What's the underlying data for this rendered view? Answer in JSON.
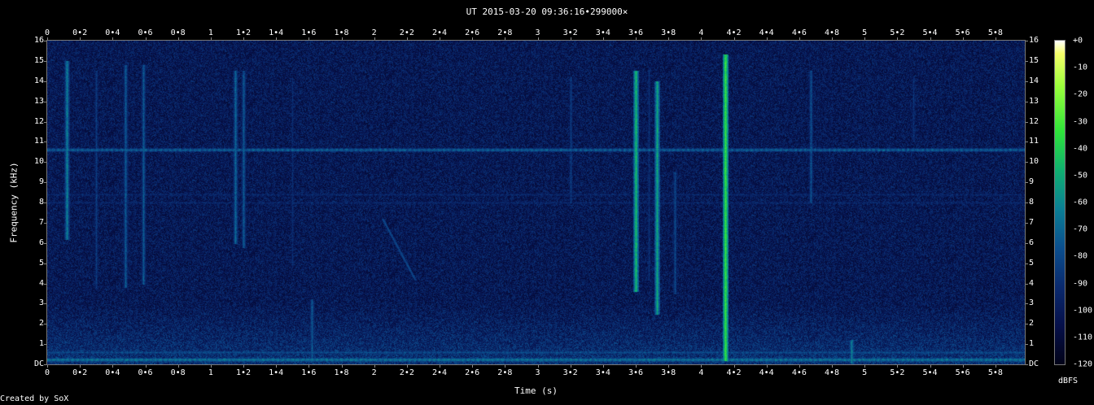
{
  "title": "UT 2015-03-20 09:36:16•299000×",
  "credit": "Created by SoX",
  "chart_data": {
    "type": "heatmap",
    "title": "UT 2015-03-20 09:36:16•299000×",
    "xlabel": "Time (s)",
    "ylabel": "Frequency (kHz)",
    "xlim": [
      0,
      5.98
    ],
    "ylim": [
      0,
      16
    ],
    "x_ticks": [
      {
        "value": 0,
        "label": "0"
      },
      {
        "value": 0.2,
        "label": "0•2"
      },
      {
        "value": 0.4,
        "label": "0•4"
      },
      {
        "value": 0.6,
        "label": "0•6"
      },
      {
        "value": 0.8,
        "label": "0•8"
      },
      {
        "value": 1,
        "label": "1"
      },
      {
        "value": 1.2,
        "label": "1•2"
      },
      {
        "value": 1.4,
        "label": "1•4"
      },
      {
        "value": 1.6,
        "label": "1•6"
      },
      {
        "value": 1.8,
        "label": "1•8"
      },
      {
        "value": 2,
        "label": "2"
      },
      {
        "value": 2.2,
        "label": "2•2"
      },
      {
        "value": 2.4,
        "label": "2•4"
      },
      {
        "value": 2.6,
        "label": "2•6"
      },
      {
        "value": 2.8,
        "label": "2•8"
      },
      {
        "value": 3,
        "label": "3"
      },
      {
        "value": 3.2,
        "label": "3•2"
      },
      {
        "value": 3.4,
        "label": "3•4"
      },
      {
        "value": 3.6,
        "label": "3•6"
      },
      {
        "value": 3.8,
        "label": "3•8"
      },
      {
        "value": 4,
        "label": "4"
      },
      {
        "value": 4.2,
        "label": "4•2"
      },
      {
        "value": 4.4,
        "label": "4•4"
      },
      {
        "value": 4.6,
        "label": "4•6"
      },
      {
        "value": 4.8,
        "label": "4•8"
      },
      {
        "value": 5,
        "label": "5"
      },
      {
        "value": 5.2,
        "label": "5•2"
      },
      {
        "value": 5.4,
        "label": "5•4"
      },
      {
        "value": 5.6,
        "label": "5•6"
      },
      {
        "value": 5.8,
        "label": "5•8"
      }
    ],
    "y_ticks": [
      {
        "value": 0,
        "label": "DC"
      },
      {
        "value": 1,
        "label": "1"
      },
      {
        "value": 2,
        "label": "2"
      },
      {
        "value": 3,
        "label": "3"
      },
      {
        "value": 4,
        "label": "4"
      },
      {
        "value": 5,
        "label": "5"
      },
      {
        "value": 6,
        "label": "6"
      },
      {
        "value": 7,
        "label": "7"
      },
      {
        "value": 8,
        "label": "8"
      },
      {
        "value": 9,
        "label": "9"
      },
      {
        "value": 10,
        "label": "10"
      },
      {
        "value": 11,
        "label": "11"
      },
      {
        "value": 12,
        "label": "12"
      },
      {
        "value": 13,
        "label": "13"
      },
      {
        "value": 14,
        "label": "14"
      },
      {
        "value": 15,
        "label": "15"
      },
      {
        "value": 16,
        "label": "16"
      }
    ],
    "colorbar": {
      "unit": "dBFS",
      "range": [
        -120,
        0
      ],
      "ticks": [
        {
          "value": 0,
          "label": "+0"
        },
        {
          "value": -10,
          "label": "-10"
        },
        {
          "value": -20,
          "label": "-20"
        },
        {
          "value": -30,
          "label": "-30"
        },
        {
          "value": -40,
          "label": "-40"
        },
        {
          "value": -50,
          "label": "-50"
        },
        {
          "value": -60,
          "label": "-60"
        },
        {
          "value": -70,
          "label": "-70"
        },
        {
          "value": -80,
          "label": "-80"
        },
        {
          "value": -90,
          "label": "-90"
        },
        {
          "value": -100,
          "label": "-100"
        },
        {
          "value": -110,
          "label": "-110"
        },
        {
          "value": -120,
          "label": "-120"
        }
      ]
    },
    "background_level_dbfs": -100,
    "horizontal_lines": [
      {
        "freq_khz": 10.6,
        "level_dbfs": -75
      },
      {
        "freq_khz": 8.4,
        "level_dbfs": -90
      },
      {
        "freq_khz": 8.0,
        "level_dbfs": -90
      },
      {
        "freq_khz": 0.25,
        "level_dbfs": -70
      },
      {
        "freq_khz": 0.6,
        "level_dbfs": -80
      }
    ],
    "vertical_events": [
      {
        "time_s": 0.12,
        "fmin_khz": 6.2,
        "fmax_khz": 15,
        "level_dbfs": -70
      },
      {
        "time_s": 0.3,
        "fmin_khz": 3.8,
        "fmax_khz": 14.5,
        "level_dbfs": -85
      },
      {
        "time_s": 0.48,
        "fmin_khz": 3.8,
        "fmax_khz": 14.8,
        "level_dbfs": -78
      },
      {
        "time_s": 0.59,
        "fmin_khz": 4.0,
        "fmax_khz": 14.8,
        "level_dbfs": -78
      },
      {
        "time_s": 1.15,
        "fmin_khz": 6.0,
        "fmax_khz": 14.5,
        "level_dbfs": -75
      },
      {
        "time_s": 1.2,
        "fmin_khz": 5.8,
        "fmax_khz": 14.5,
        "level_dbfs": -78
      },
      {
        "time_s": 1.5,
        "fmin_khz": 4.8,
        "fmax_khz": 14.2,
        "level_dbfs": -90
      },
      {
        "time_s": 1.62,
        "fmin_khz": 0.2,
        "fmax_khz": 3.2,
        "level_dbfs": -78
      },
      {
        "time_s": 3.2,
        "fmin_khz": 8.0,
        "fmax_khz": 14.2,
        "level_dbfs": -85
      },
      {
        "time_s": 3.6,
        "fmin_khz": 3.6,
        "fmax_khz": 14.5,
        "level_dbfs": -58
      },
      {
        "time_s": 3.68,
        "fmin_khz": 4.2,
        "fmax_khz": 14.5,
        "level_dbfs": -88
      },
      {
        "time_s": 3.73,
        "fmin_khz": 2.5,
        "fmax_khz": 14,
        "level_dbfs": -62
      },
      {
        "time_s": 3.84,
        "fmin_khz": 3.5,
        "fmax_khz": 9.5,
        "level_dbfs": -82
      },
      {
        "time_s": 4.15,
        "fmin_khz": 0.2,
        "fmax_khz": 15.3,
        "level_dbfs": -50
      },
      {
        "time_s": 4.67,
        "fmin_khz": 8.0,
        "fmax_khz": 14.5,
        "level_dbfs": -80
      },
      {
        "time_s": 4.92,
        "fmin_khz": 0.1,
        "fmax_khz": 1.2,
        "level_dbfs": -70
      },
      {
        "time_s": 5.3,
        "fmin_khz": 11.0,
        "fmax_khz": 14.2,
        "level_dbfs": -88
      }
    ],
    "sweeps": [
      {
        "t_start_s": 2.05,
        "f_start_khz": 7.2,
        "t_end_s": 2.25,
        "f_end_khz": 4.2,
        "level_dbfs": -85
      }
    ]
  }
}
